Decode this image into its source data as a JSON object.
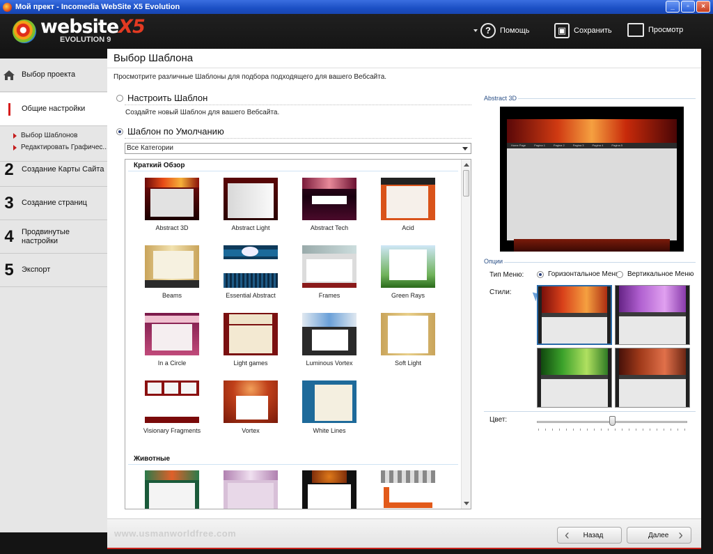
{
  "window": {
    "title": "Мой прект - Incomedia WebSite X5 Evolution"
  },
  "logo": {
    "main": "website",
    "x5": "X5",
    "sub": "EVOLUTION 9"
  },
  "header": {
    "help": "Помощь",
    "save": "Сохранить",
    "preview": "Просмотр"
  },
  "sidebar": {
    "steps": [
      {
        "num": "",
        "label": "Выбор проекта"
      },
      {
        "num": "",
        "label": "Общие настройки"
      },
      {
        "num": "2",
        "label": "Создание Карты Сайта"
      },
      {
        "num": "3",
        "label": "Создание страниц"
      },
      {
        "num": "4",
        "label": "Продвинутые настройки"
      },
      {
        "num": "5",
        "label": "Экспорт"
      }
    ],
    "substeps": [
      "Выбор Шаблонов",
      "Редактировать Графичес..."
    ]
  },
  "main": {
    "title": "Выбор Шаблона",
    "description": "Просмотрите различные Шаблоны для подбора подходящего для вашего Вебсайта.",
    "custom_option": "Настроить Шаблон",
    "custom_desc": "Создайте новый Шаблон для вашего Вебсайта.",
    "default_option": "Шаблон по Умолчанию",
    "category_select": "Все Категории"
  },
  "gallery": {
    "sections": [
      "Краткий Обзор",
      "Животные"
    ],
    "templates": [
      "Abstract 3D",
      "Abstract Light",
      "Abstract Tech",
      "Acid",
      "Beams",
      "Essential Abstract",
      "Frames",
      "Green Rays",
      "In a Circle",
      "Light games",
      "Luminous Vortex",
      "Soft Light",
      "Visionary Fragments",
      "Vortex",
      "White Lines"
    ]
  },
  "preview": {
    "label": "Abstract 3D",
    "menu_items": [
      "Home Page",
      "Pagina 1",
      "Pagina 2",
      "Pagina 3",
      "Pagina 4",
      "Pagina 5"
    ]
  },
  "options": {
    "label": "Опции",
    "menu_type_label": "Тип Меню:",
    "menu_horizontal": "Горизонтальное Меню",
    "menu_vertical": "Вертикальное Меню",
    "styles_label": "Стили:",
    "color_label": "Цвет:"
  },
  "colors": {
    "accent_red": "#c8211a",
    "option_blue": "#2a4f86"
  },
  "footer": {
    "watermark": "www.usmanworldfree.com",
    "back": "Назад",
    "next": "Далее"
  }
}
